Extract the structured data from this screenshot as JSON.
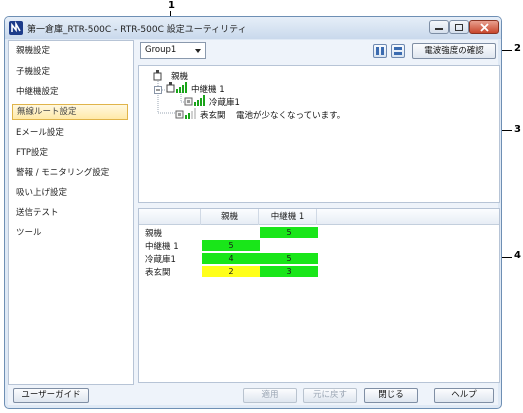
{
  "callouts": [
    "1",
    "2",
    "3",
    "4"
  ],
  "window": {
    "title": "第一倉庫_RTR-500C - RTR-500C 設定ユーティリティ"
  },
  "sidebar": {
    "items": [
      {
        "label": "親機設定"
      },
      {
        "label": "子機設定"
      },
      {
        "label": "中継機設定"
      },
      {
        "label": "無線ルート設定",
        "active": true
      },
      {
        "label": "Eメール設定"
      },
      {
        "label": "FTP設定"
      },
      {
        "label": "警報 / モニタリング設定"
      },
      {
        "label": "吸い上げ設定"
      },
      {
        "label": "送信テスト"
      },
      {
        "label": "ツール"
      }
    ]
  },
  "toolbar": {
    "group_value": "Group1",
    "signal_check_label": "電波強度の確認"
  },
  "tree": {
    "root": "親機",
    "relay": "中継機 1",
    "relay_child": "冷蔵庫1",
    "direct_child": "表玄関",
    "direct_child_status": "電池が少なくなっています。"
  },
  "signal_table": {
    "columns": [
      "親機",
      "中継機 1"
    ],
    "rows": [
      {
        "label": "親機",
        "cells": [
          "",
          "5"
        ]
      },
      {
        "label": "中継機 1",
        "cells": [
          "5",
          ""
        ]
      },
      {
        "label": "冷蔵庫1",
        "cells": [
          "4",
          "5"
        ]
      },
      {
        "label": "表玄関",
        "cells": [
          "2",
          "3"
        ]
      }
    ],
    "colors": {
      "good": "#19e619",
      "weak": "#ffff1a"
    }
  },
  "footer": {
    "user_guide": "ユーザーガイド",
    "apply": "適用",
    "revert": "元に戻す",
    "close": "閉じる",
    "help": "ヘルプ"
  }
}
